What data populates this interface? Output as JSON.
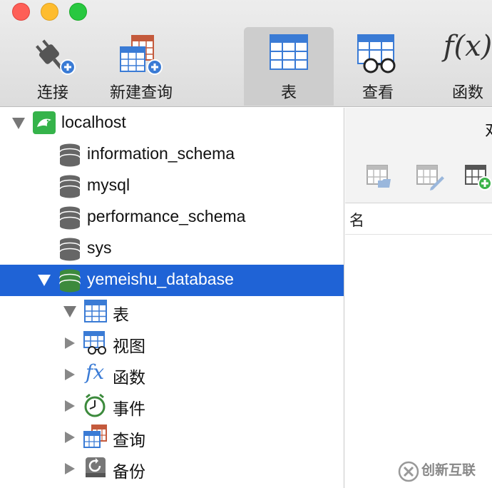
{
  "toolbar": {
    "items": [
      {
        "label": "连接",
        "icon": "plug-add-icon"
      },
      {
        "label": "新建查询",
        "icon": "new-query-icon"
      },
      {
        "label": "表",
        "icon": "table-icon",
        "active": true
      },
      {
        "label": "查看",
        "icon": "view-icon"
      },
      {
        "label": "函数",
        "icon": "function-icon"
      }
    ],
    "function_glyph": "f(x)"
  },
  "tree": {
    "connection": {
      "label": "localhost",
      "icon": "mysql-connection-icon"
    },
    "databases": [
      {
        "label": "information_schema",
        "icon": "database-icon"
      },
      {
        "label": "mysql",
        "icon": "database-icon"
      },
      {
        "label": "performance_schema",
        "icon": "database-icon"
      },
      {
        "label": "sys",
        "icon": "database-icon"
      },
      {
        "label": "yemeishu_database",
        "icon": "database-open-icon",
        "selected": true
      }
    ],
    "children": [
      {
        "label": "表",
        "icon": "table-icon",
        "expanded": true
      },
      {
        "label": "视图",
        "icon": "view-icon"
      },
      {
        "label": "函数",
        "icon": "function-icon",
        "glyph": "fx"
      },
      {
        "label": "事件",
        "icon": "clock-icon"
      },
      {
        "label": "查询",
        "icon": "query-icon"
      },
      {
        "label": "备份",
        "icon": "backup-icon"
      }
    ]
  },
  "pane": {
    "title": "对",
    "header_column": "名"
  },
  "watermark": {
    "brand": "创新互联"
  },
  "colors": {
    "selection": "#1f63d6",
    "accent_blue": "#3a7bd5",
    "db_gray": "#666666",
    "db_green": "#3c8a3c"
  }
}
